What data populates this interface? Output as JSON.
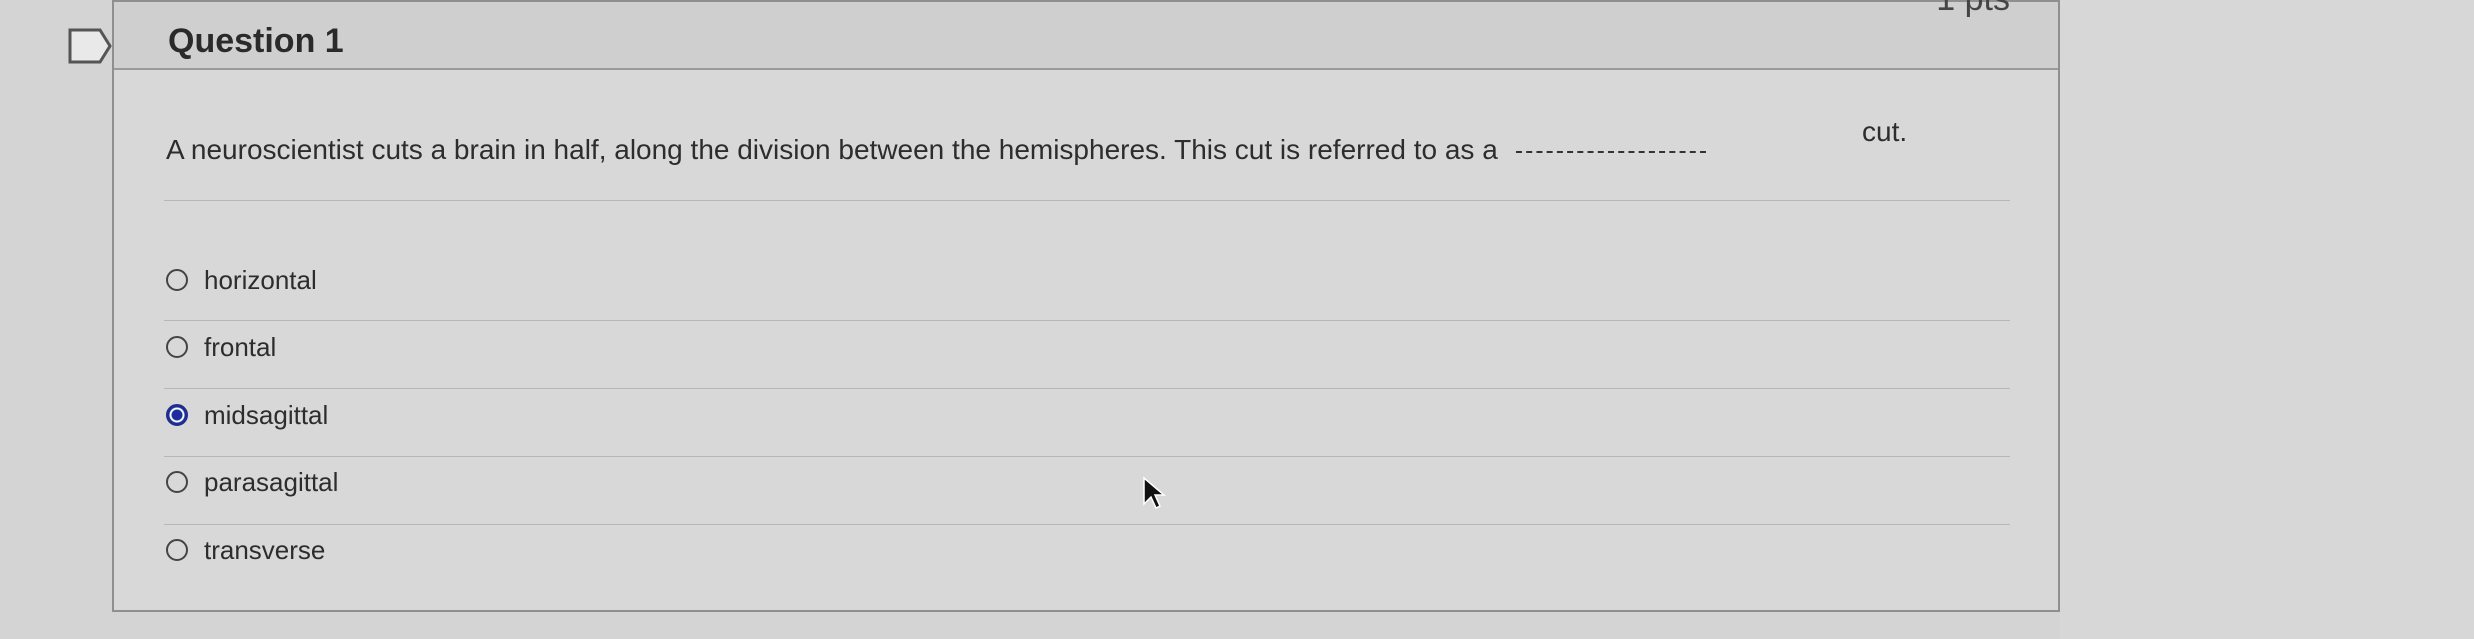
{
  "question": {
    "title": "Question 1",
    "points": "1 pts",
    "text": "A neuroscientist cuts a brain in half, along the division between the hemispheres. This cut is referred to as a",
    "tail": "cut."
  },
  "answers": [
    {
      "label": "horizontal",
      "selected": false
    },
    {
      "label": "frontal",
      "selected": false
    },
    {
      "label": "midsagittal",
      "selected": true
    },
    {
      "label": "parasagittal",
      "selected": false
    },
    {
      "label": "transverse",
      "selected": false
    }
  ],
  "icons": {
    "flag": "flag-icon",
    "radio_unselected": "radio-unselected-icon",
    "radio_selected": "radio-selected-icon",
    "cursor": "pointer-cursor-icon"
  },
  "colors": {
    "background": "#d4d4d4",
    "selected_radio": "#1b2e9e",
    "border": "#8f8f8f"
  }
}
